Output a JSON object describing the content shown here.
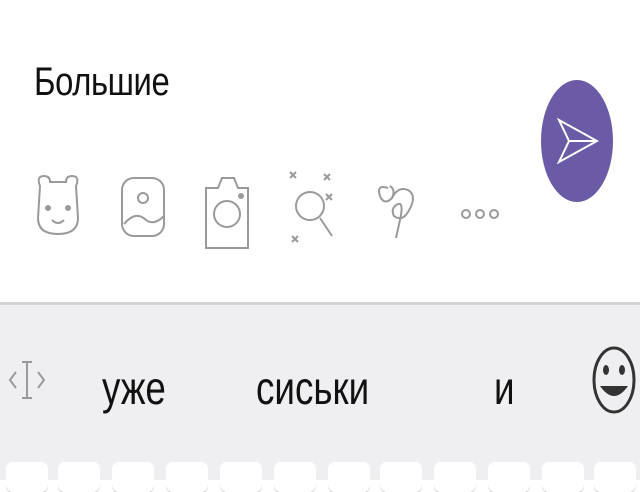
{
  "composer": {
    "message_text": "Большие"
  },
  "toolbar": {
    "icons": [
      "sticker-icon",
      "gallery-icon",
      "camera-icon",
      "gif-icon",
      "doodle-icon",
      "more-icon"
    ],
    "send": {
      "icon": "send-icon",
      "color": "#6b5aa5"
    }
  },
  "suggestions": {
    "words": [
      "уже",
      "сиськи",
      "и"
    ]
  },
  "keyboard": {
    "cursor_icon": "cursor-control-icon",
    "emoji_icon": "emoji-icon",
    "accent_color": "#6b5aa5"
  }
}
